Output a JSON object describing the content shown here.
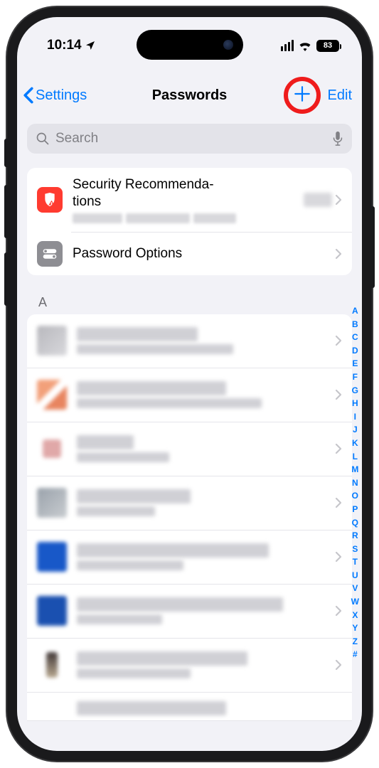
{
  "status": {
    "time": "10:14",
    "battery": "83"
  },
  "nav": {
    "back": "Settings",
    "title": "Passwords",
    "edit": "Edit"
  },
  "search": {
    "placeholder": "Search"
  },
  "options": {
    "rec_title": "Security Recommenda-\ntions",
    "pwd_options": "Password Options"
  },
  "section": {
    "letter": "A"
  },
  "index": [
    "A",
    "B",
    "C",
    "D",
    "E",
    "F",
    "G",
    "H",
    "I",
    "J",
    "K",
    "L",
    "M",
    "N",
    "O",
    "P",
    "Q",
    "R",
    "S",
    "T",
    "U",
    "V",
    "W",
    "X",
    "Y",
    "Z",
    "#"
  ]
}
